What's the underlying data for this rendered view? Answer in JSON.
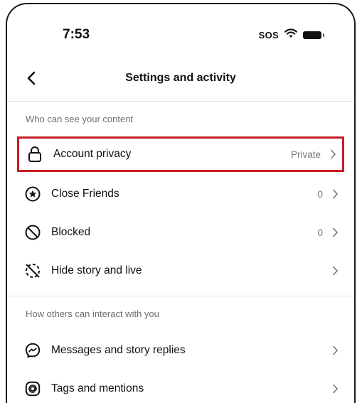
{
  "status_bar": {
    "time": "7:53",
    "carrier": "SOS"
  },
  "header": {
    "title": "Settings and activity"
  },
  "sections": [
    {
      "title": "Who can see your content",
      "items": [
        {
          "label": "Account privacy",
          "value": "Private",
          "icon": "lock-icon",
          "highlighted": true
        },
        {
          "label": "Close Friends",
          "value": "0",
          "icon": "star-circle-icon"
        },
        {
          "label": "Blocked",
          "value": "0",
          "icon": "blocked-icon"
        },
        {
          "label": "Hide story and live",
          "value": "",
          "icon": "hide-story-icon"
        }
      ]
    },
    {
      "title": "How others can interact with you",
      "items": [
        {
          "label": "Messages and story replies",
          "value": "",
          "icon": "messenger-icon"
        },
        {
          "label": "Tags and mentions",
          "value": "",
          "icon": "at-sign-icon"
        }
      ]
    }
  ],
  "colors": {
    "highlight": "#c81e23",
    "text": "#111111",
    "secondary_text": "#777777"
  }
}
